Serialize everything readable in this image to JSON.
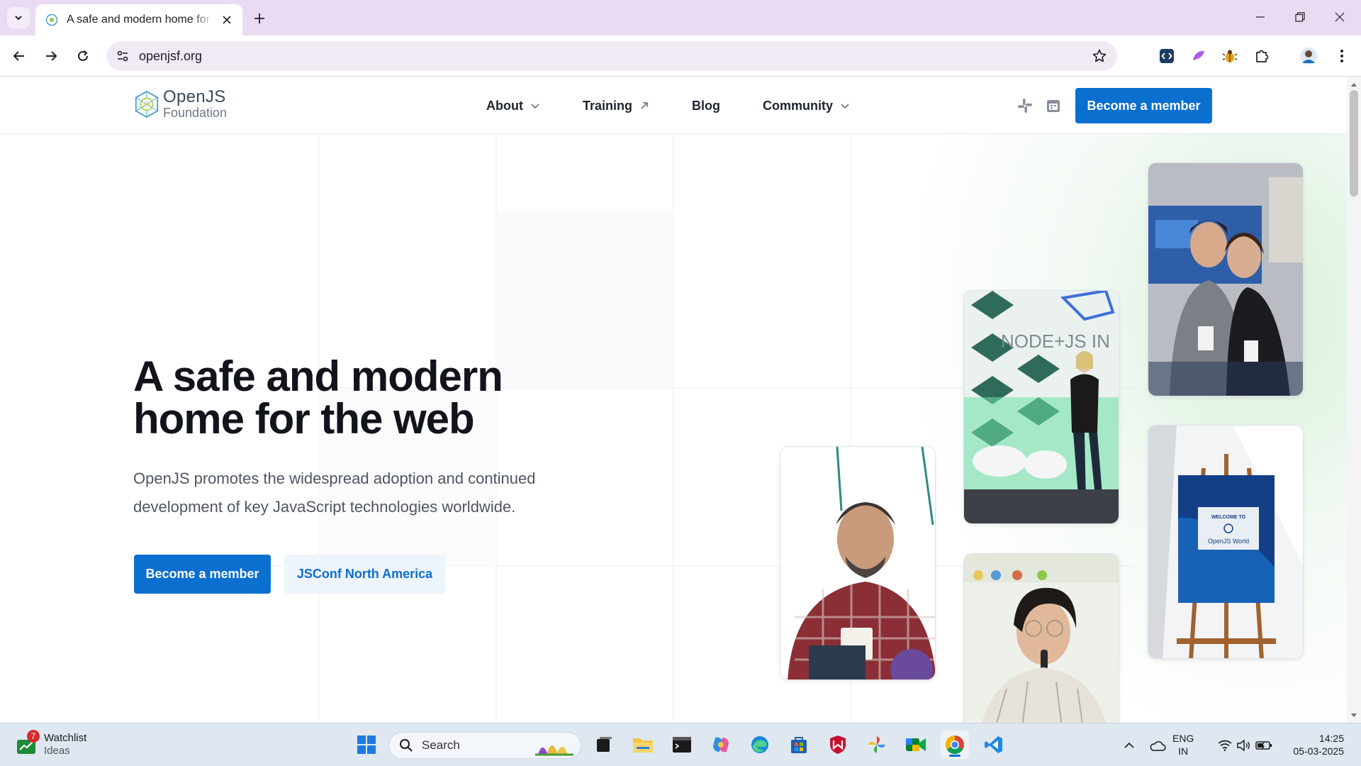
{
  "browser": {
    "tab_title": "A safe and modern home for JavaScript",
    "url": "openjsf.org"
  },
  "site": {
    "logo": {
      "line1": "OpenJS",
      "line2": "Foundation"
    },
    "nav": [
      {
        "label": "About"
      },
      {
        "label": "Training"
      },
      {
        "label": "Blog"
      },
      {
        "label": "Community"
      }
    ],
    "header_cta": "Become a member"
  },
  "hero": {
    "title_line1": "A safe and modern",
    "title_line2": "home for the web",
    "subtitle": "OpenJS promotes the widespread adoption and continued development of key JavaScript technologies worldwide.",
    "cta_primary": "Become a member",
    "cta_secondary": "JSConf North America",
    "photos": {
      "stage_sign": "NODE+JS IN",
      "poster_welcome": "WELCOME TO",
      "poster_name": "OpenJS World"
    }
  },
  "taskbar": {
    "weather_badge": "7",
    "weather_line1": "Watchlist",
    "weather_line2": "Ideas",
    "search_placeholder": "Search",
    "lang_line1": "ENG",
    "lang_line2": "IN",
    "time": "14:25",
    "date": "05-03-2025"
  },
  "colors": {
    "brand_blue": "#0b6fd0",
    "title_ink": "#12141c",
    "chrome_tabstrip": "#e9dcf2"
  }
}
